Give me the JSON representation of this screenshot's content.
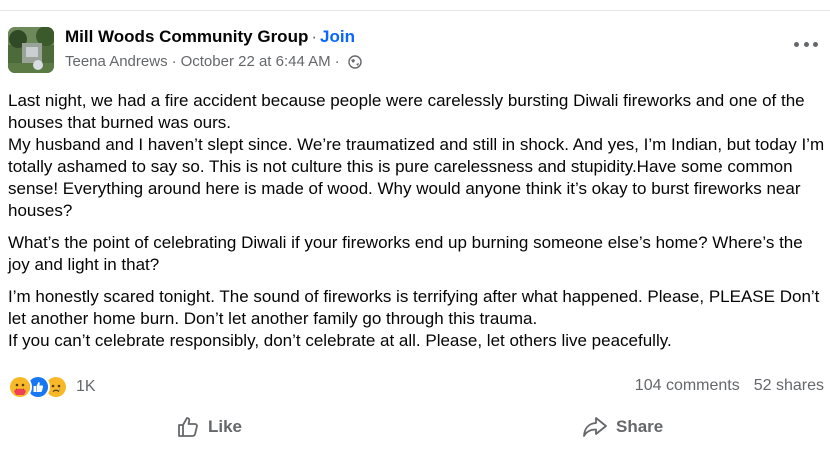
{
  "header": {
    "group_name": "Mill Woods Community Group",
    "dot": "·",
    "join_label": "Join",
    "author": "Teena Andrews",
    "separator": "·",
    "timestamp": "October 22 at 6:44 AM",
    "separator2": "·",
    "privacy_icon": "globe-icon",
    "more_icon": "more-options-icon"
  },
  "post": {
    "paragraphs": [
      "Last night, we had a fire accident because people were carelessly bursting Diwali fireworks and one of the houses that burned was ours.",
      "My husband and I haven’t slept since. We’re traumatized and still in shock. And yes, I’m Indian, but today I’m totally ashamed to say so. This is not culture this is pure carelessness and stupidity.Have some common sense! Everything around here is made of wood. Why would anyone think it’s okay to burst fireworks near houses?",
      "What’s the point of celebrating Diwali if your fireworks end up burning someone else’s home? Where’s the joy and light in that?",
      "I’m honestly scared tonight. The sound of fireworks is terrifying after what happened. Please, PLEASE Don’t let another home burn. Don’t let another family go through this trauma.",
      "If you can’t celebrate responsibly, don’t celebrate at all. Please, let others live peacefully."
    ]
  },
  "engagement": {
    "reaction_icons": [
      "care-reaction-icon",
      "like-reaction-icon",
      "sad-reaction-icon"
    ],
    "reaction_count": "1K",
    "comments": "104 comments",
    "shares": "52 shares"
  },
  "actions": {
    "like_label": "Like",
    "share_label": "Share"
  },
  "colors": {
    "accent": "#0866ff",
    "secondary_text": "#65676b",
    "primary_text": "#050505"
  }
}
